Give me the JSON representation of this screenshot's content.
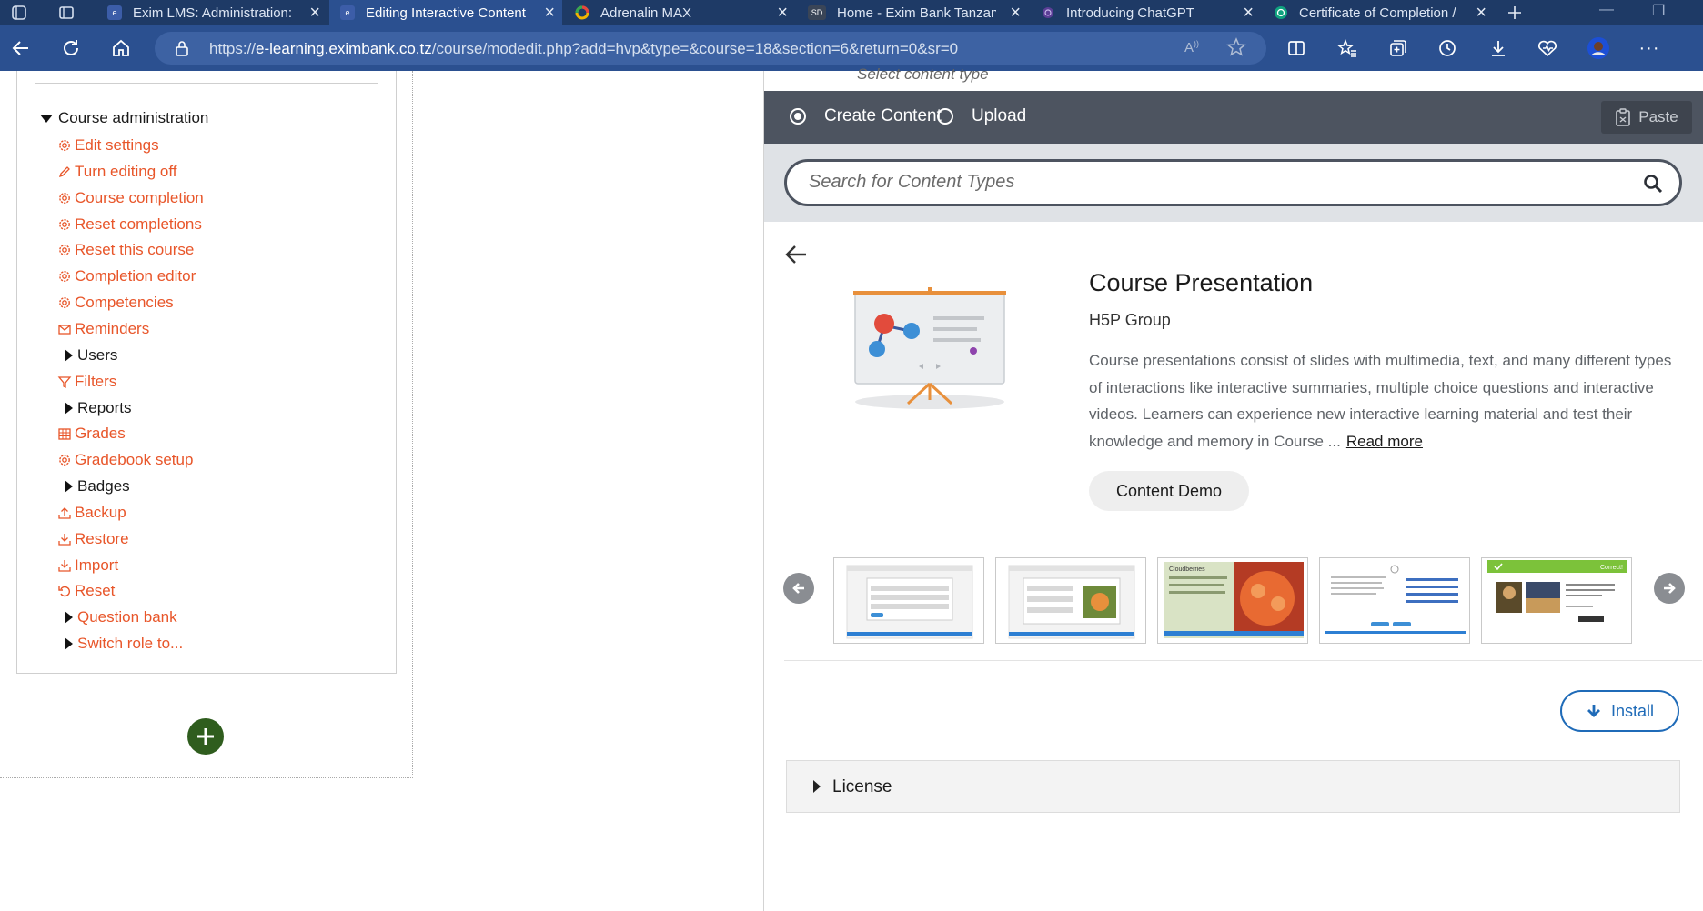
{
  "browser": {
    "tabs": [
      {
        "title": "Exim LMS: Administration:",
        "active": false
      },
      {
        "title": "Editing Interactive Content",
        "active": true
      },
      {
        "title": "Adrenalin MAX",
        "active": false
      },
      {
        "title": "Home - Exim Bank Tanzania",
        "active": false
      },
      {
        "title": "Introducing ChatGPT",
        "active": false
      },
      {
        "title": "Certificate of Completion /",
        "active": false
      }
    ],
    "sd_fav": "SD",
    "url_prefix": "https://",
    "url_host": "e-learning.eximbank.co.tz",
    "url_path": "/course/modedit.php?add=hvp&type=&course=18&section=6&return=0&sr=0"
  },
  "admin": {
    "heading": "Course administration",
    "items": [
      {
        "label": "Edit settings",
        "icon": "gear-icon",
        "type": "link"
      },
      {
        "label": "Turn editing off",
        "icon": "pencil-icon",
        "type": "link"
      },
      {
        "label": "Course completion",
        "icon": "gear-icon",
        "type": "link"
      },
      {
        "label": "Reset completions",
        "icon": "gear-icon",
        "type": "link"
      },
      {
        "label": "Reset this course",
        "icon": "gear-icon",
        "type": "link"
      },
      {
        "label": "Completion editor",
        "icon": "gear-icon",
        "type": "link"
      },
      {
        "label": "Competencies",
        "icon": "gear-icon",
        "type": "link"
      },
      {
        "label": "Reminders",
        "icon": "envelope-icon",
        "type": "link"
      },
      {
        "label": "Users",
        "icon": "caret-right-icon",
        "type": "branch"
      },
      {
        "label": "Filters",
        "icon": "filter-icon",
        "type": "link"
      },
      {
        "label": "Reports",
        "icon": "caret-right-icon",
        "type": "branch"
      },
      {
        "label": "Grades",
        "icon": "table-icon",
        "type": "link"
      },
      {
        "label": "Gradebook setup",
        "icon": "gear-icon",
        "type": "link"
      },
      {
        "label": "Badges",
        "icon": "caret-right-icon",
        "type": "branch"
      },
      {
        "label": "Backup",
        "icon": "upload-icon",
        "type": "link"
      },
      {
        "label": "Restore",
        "icon": "download-icon",
        "type": "link"
      },
      {
        "label": "Import",
        "icon": "download-icon",
        "type": "link"
      },
      {
        "label": "Reset",
        "icon": "undo-icon",
        "type": "link"
      },
      {
        "label": "Question bank",
        "icon": "caret-right-icon",
        "type": "branch-link"
      },
      {
        "label": "Switch role to...",
        "icon": "caret-right-icon",
        "type": "branch-link"
      }
    ]
  },
  "hub": {
    "header_stub": "Select content type",
    "tab_create": "Create Content",
    "tab_upload": "Upload",
    "paste": "Paste",
    "search_placeholder": "Search for Content Types",
    "content_type": {
      "title": "Course Presentation",
      "owner": "H5P Group",
      "description": "Course presentations consist of slides with multimedia, text, and many different types of interactions like interactive summaries, multiple choice questions and interactive videos. Learners can experience new interactive learning material and test their knowledge and memory in Course ...",
      "read_more": "Read more",
      "demo": "Content Demo",
      "install": "Install",
      "license": "License",
      "thumb_correct": "Correct!",
      "thumb_headline": "Cloudberries"
    }
  },
  "colors": {
    "link": "#e8562a",
    "tabbar": "#1e3a66",
    "addrbar": "#2b5090",
    "hub_tabs": "#4d5460",
    "install": "#1f6bb8"
  }
}
